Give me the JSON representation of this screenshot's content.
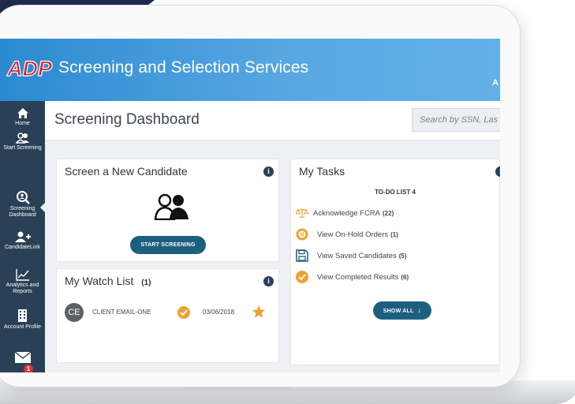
{
  "app": {
    "title": "Screening and Selection Services",
    "topbar_edge_text": "A"
  },
  "sidebar": {
    "items": [
      {
        "label": "Home",
        "icon": "home-icon"
      },
      {
        "label": "Start Screening",
        "icon": "people-icon"
      },
      {
        "label": "Screening Dashboard",
        "icon": "search-people-icon"
      },
      {
        "label": "CandidateLink",
        "icon": "add-user-icon"
      },
      {
        "label": "Analytics and Reports",
        "icon": "line-chart-icon"
      },
      {
        "label": "Account Profile",
        "icon": "building-icon"
      },
      {
        "label": "",
        "icon": "mail-icon",
        "badge": "1"
      }
    ]
  },
  "dashboard": {
    "title": "Screening Dashboard",
    "search_placeholder": "Search by SSN, Las"
  },
  "screen_card": {
    "title": "Screen a New Candidate",
    "button": "START SCREENING"
  },
  "watch_card": {
    "title": "My Watch List",
    "count": "(1)",
    "rows": [
      {
        "initials": "CE",
        "name": "CLIENT EMAIL-ONE",
        "date": "03/06/2018"
      }
    ]
  },
  "tasks_card": {
    "title": "My Tasks",
    "todo_heading": "TO-DO LIST 4",
    "tasks": [
      {
        "label": "Acknowledge FCRA",
        "count": "(22)",
        "icon": "scales-icon"
      },
      {
        "label": "View On-Hold Orders",
        "count": "(1)",
        "icon": "pause-icon"
      },
      {
        "label": "View Saved Candidates",
        "count": "(5)",
        "icon": "save-icon"
      },
      {
        "label": "View Completed Results",
        "count": "(6)",
        "icon": "check-icon"
      }
    ],
    "show_all": "SHOW ALL"
  },
  "colors": {
    "topbar": "#2b8ad1",
    "sidebar": "#2a4056",
    "accent_orange": "#f0a030",
    "pill": "#1d5f7f",
    "logo_red": "#d0212d"
  }
}
